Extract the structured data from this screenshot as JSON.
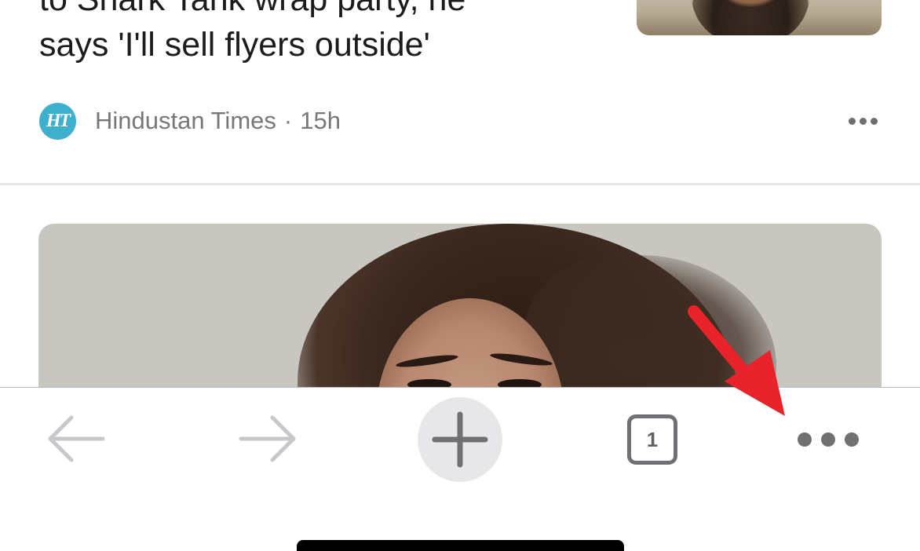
{
  "article_1": {
    "headline_line_1": "to Shark Tank wrap party, he",
    "headline_line_2": "says 'I'll sell flyers outside'",
    "source": {
      "logo_text": "HT",
      "name": "Hindustan Times",
      "separator": "·",
      "age": "15h"
    },
    "more_icon": "ellipsis-horizontal-icon"
  },
  "article_2": {
    "image": "hero-photo-woman-portrait"
  },
  "toolbar": {
    "back_icon": "arrow-left-icon",
    "forward_icon": "arrow-right-icon",
    "new_tab_icon": "plus-icon",
    "tab_count": "1",
    "menu_icon": "ellipsis-horizontal-icon"
  },
  "annotation": {
    "arrow_color": "#e8232a"
  },
  "colors": {
    "toolbar_icon_active": "#6e7074",
    "toolbar_icon_disabled": "#c7c7cc",
    "new_tab_bg": "#e7e7ea",
    "source_text": "#77777c",
    "ht_logo_bg": "#3fb0cc"
  }
}
